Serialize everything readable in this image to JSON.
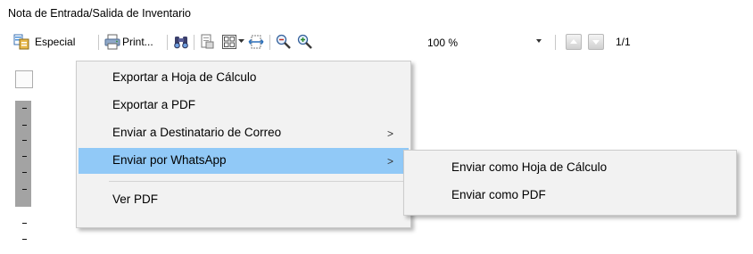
{
  "window": {
    "title": "Nota de Entrada/Salida de Inventario"
  },
  "toolbar": {
    "special_label": "Especial",
    "print_label": "Print...",
    "zoom_value": "100 %",
    "page_indicator": "1/1"
  },
  "context_menu": {
    "items": [
      {
        "label": "Exportar a Hoja de Cálculo"
      },
      {
        "label": "Exportar a PDF"
      },
      {
        "label": "Enviar a Destinatario de Correo"
      },
      {
        "label": "Enviar  por WhatsApp"
      },
      {
        "label": "Ver PDF"
      }
    ],
    "highlighted_index": 3,
    "submenu_arrow": ">"
  },
  "submenu": {
    "items": [
      {
        "label": "Enviar como Hoja de Cálculo"
      },
      {
        "label": "Enviar como PDF"
      }
    ]
  },
  "colors": {
    "highlight": "#91c9f7",
    "menu_bg": "#f2f2f2"
  }
}
